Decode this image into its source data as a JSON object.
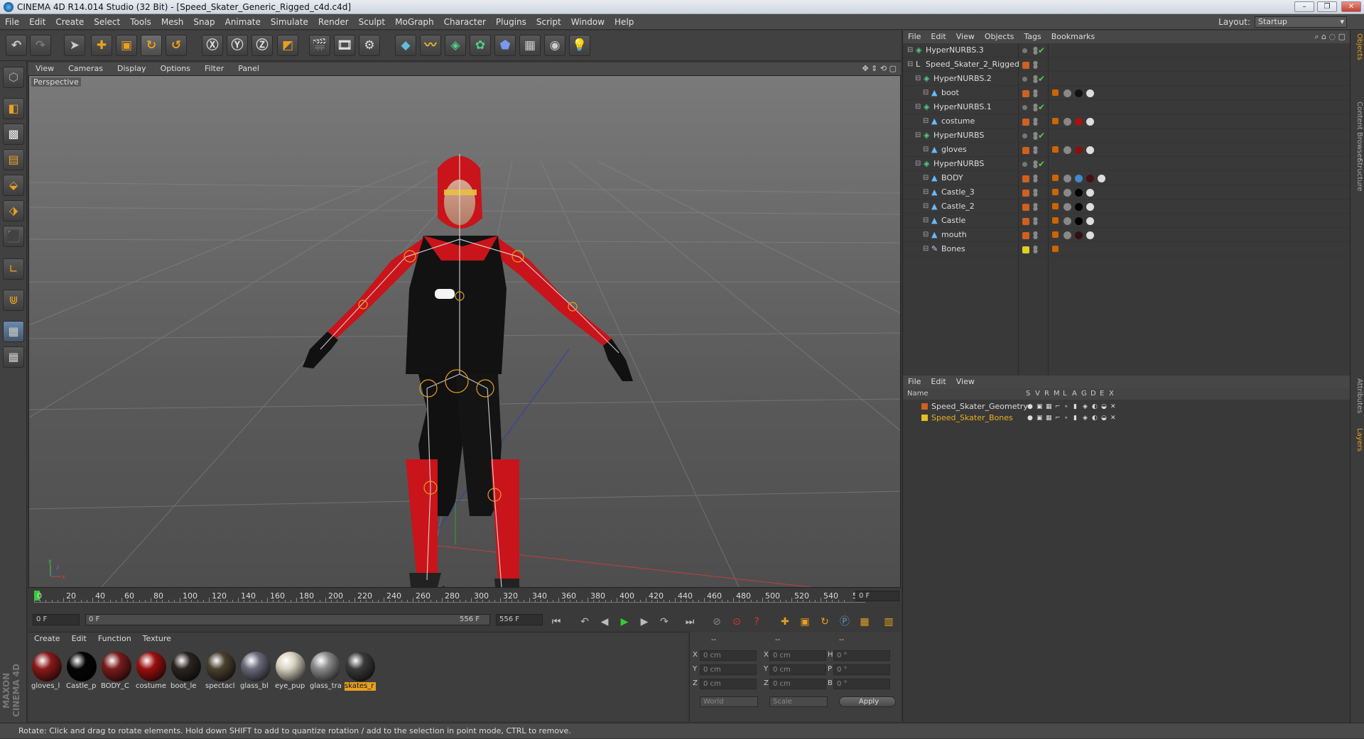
{
  "window": {
    "title": "CINEMA 4D R14.014 Studio (32 Bit) - [Speed_Skater_Generic_Rigged_c4d.c4d]",
    "minimize": "–",
    "restore": "❐",
    "close": "✕"
  },
  "menubar": {
    "items": [
      "File",
      "Edit",
      "Create",
      "Select",
      "Tools",
      "Mesh",
      "Snap",
      "Animate",
      "Simulate",
      "Render",
      "Sculpt",
      "MoGraph",
      "Character",
      "Plugins",
      "Script",
      "Window",
      "Help"
    ],
    "layout_label": "Layout:",
    "layout_value": "Startup"
  },
  "viewport": {
    "menu": [
      "View",
      "Cameras",
      "Display",
      "Options",
      "Filter",
      "Panel"
    ],
    "label": "Perspective",
    "axis_y": "y",
    "axis_x": "x",
    "axis_z": "z"
  },
  "timeline": {
    "ticks": [
      "0",
      "20",
      "40",
      "60",
      "80",
      "100",
      "120",
      "140",
      "160",
      "180",
      "200",
      "220",
      "240",
      "260",
      "280",
      "300",
      "320",
      "340",
      "360",
      "380",
      "400",
      "420",
      "440",
      "460",
      "480",
      "500",
      "520",
      "540",
      "5"
    ],
    "current_frame": "0 F"
  },
  "transport": {
    "start_field": "0 F",
    "range_start": "0 F",
    "range_end": "556 F",
    "end_field": "556 F"
  },
  "materials": {
    "menu": [
      "Create",
      "Edit",
      "Function",
      "Texture"
    ],
    "items": [
      {
        "label": "gloves_l",
        "color": "#8a1a1a"
      },
      {
        "label": "Castle_p",
        "color": "#050505"
      },
      {
        "label": "BODY_C",
        "color": "#7a1c1c"
      },
      {
        "label": "costume",
        "color": "#9a1010"
      },
      {
        "label": "boot_le",
        "color": "#2a2520"
      },
      {
        "label": "spectacl",
        "color": "#4a4030"
      },
      {
        "label": "glass_bl",
        "color": "#6a6a7a"
      },
      {
        "label": "eye_pup",
        "color": "#d8d2c0"
      },
      {
        "label": "glass_tra",
        "color": "#8a8a8a"
      },
      {
        "label": "skates_r",
        "color": "#3a3a3a"
      }
    ]
  },
  "coords": {
    "header1": "--",
    "header2": "--",
    "header3": "--",
    "rows": [
      {
        "l1": "X",
        "v1": "0 cm",
        "l2": "X",
        "v2": "0 cm",
        "l3": "H",
        "v3": "0 °"
      },
      {
        "l1": "Y",
        "v1": "0 cm",
        "l2": "Y",
        "v2": "0 cm",
        "l3": "P",
        "v3": "0 °"
      },
      {
        "l1": "Z",
        "v1": "0 cm",
        "l2": "Z",
        "v2": "0 cm",
        "l3": "B",
        "v3": "0 °"
      }
    ],
    "world": "World",
    "scale": "Scale",
    "apply": "Apply"
  },
  "status": "Rotate: Click and drag to rotate elements. Hold down SHIFT to add to quantize rotation / add to the selection in point mode, CTRL to remove.",
  "brand": "MAXON CINEMA 4D",
  "objects": {
    "menu": [
      "File",
      "Edit",
      "View",
      "Objects",
      "Tags",
      "Bookmarks"
    ],
    "rows": [
      {
        "name": "HyperNURBS.3",
        "indent": 0,
        "kind": "nurbs",
        "check": true,
        "tags": []
      },
      {
        "name": "Speed_Skater_2_Rigged",
        "indent": 0,
        "kind": "null",
        "check": false,
        "tags": []
      },
      {
        "name": "HyperNURBS.2",
        "indent": 1,
        "kind": "nurbs",
        "check": true,
        "tags": []
      },
      {
        "name": "boot",
        "indent": 2,
        "kind": "mesh",
        "check": false,
        "tags": [
          "#c60",
          "#888",
          "#111",
          "#ddd"
        ]
      },
      {
        "name": "HyperNURBS.1",
        "indent": 1,
        "kind": "nurbs",
        "check": true,
        "tags": []
      },
      {
        "name": "costume",
        "indent": 2,
        "kind": "mesh",
        "check": false,
        "tags": [
          "#c60",
          "#888",
          "#a11",
          "#ddd"
        ]
      },
      {
        "name": "HyperNURBS",
        "indent": 1,
        "kind": "nurbs",
        "check": true,
        "tags": []
      },
      {
        "name": "gloves",
        "indent": 2,
        "kind": "mesh",
        "check": false,
        "tags": [
          "#c60",
          "#888",
          "#811",
          "#ddd"
        ]
      },
      {
        "name": "HyperNURBS",
        "indent": 1,
        "kind": "nurbs",
        "check": true,
        "tags": []
      },
      {
        "name": "BODY",
        "indent": 2,
        "kind": "mesh",
        "check": false,
        "tags": [
          "#c60",
          "#888",
          "#48c",
          "#411",
          "#ddd"
        ]
      },
      {
        "name": "Castle_3",
        "indent": 2,
        "kind": "mesh",
        "check": false,
        "tags": [
          "#c60",
          "#888",
          "#000",
          "#ddd"
        ]
      },
      {
        "name": "Castle_2",
        "indent": 2,
        "kind": "mesh",
        "check": false,
        "tags": [
          "#c60",
          "#888",
          "#000",
          "#ddd"
        ]
      },
      {
        "name": "Castle",
        "indent": 2,
        "kind": "mesh",
        "check": false,
        "tags": [
          "#c60",
          "#888",
          "#000",
          "#ddd"
        ]
      },
      {
        "name": "mouth",
        "indent": 2,
        "kind": "mesh",
        "check": false,
        "tags": [
          "#c60",
          "#888",
          "#311",
          "#ddd"
        ]
      },
      {
        "name": "Bones",
        "indent": 2,
        "kind": "bone",
        "check": false,
        "tags": [
          "#c60"
        ]
      }
    ]
  },
  "layers": {
    "menu": [
      "File",
      "Edit",
      "View"
    ],
    "columns": [
      "Name",
      "S",
      "V",
      "R",
      "M",
      "L",
      "A",
      "G",
      "D",
      "E",
      "X"
    ],
    "rows": [
      {
        "name": "Speed_Skater_Geometry",
        "color": "#d06020",
        "text_color": "#dddddd"
      },
      {
        "name": "Speed_Skater_Bones",
        "color": "#e0c020",
        "text_color": "#e8b020"
      }
    ]
  },
  "right_tabs": [
    "Objects",
    "Content Browser",
    "Structure",
    "Attributes",
    "Layers"
  ]
}
